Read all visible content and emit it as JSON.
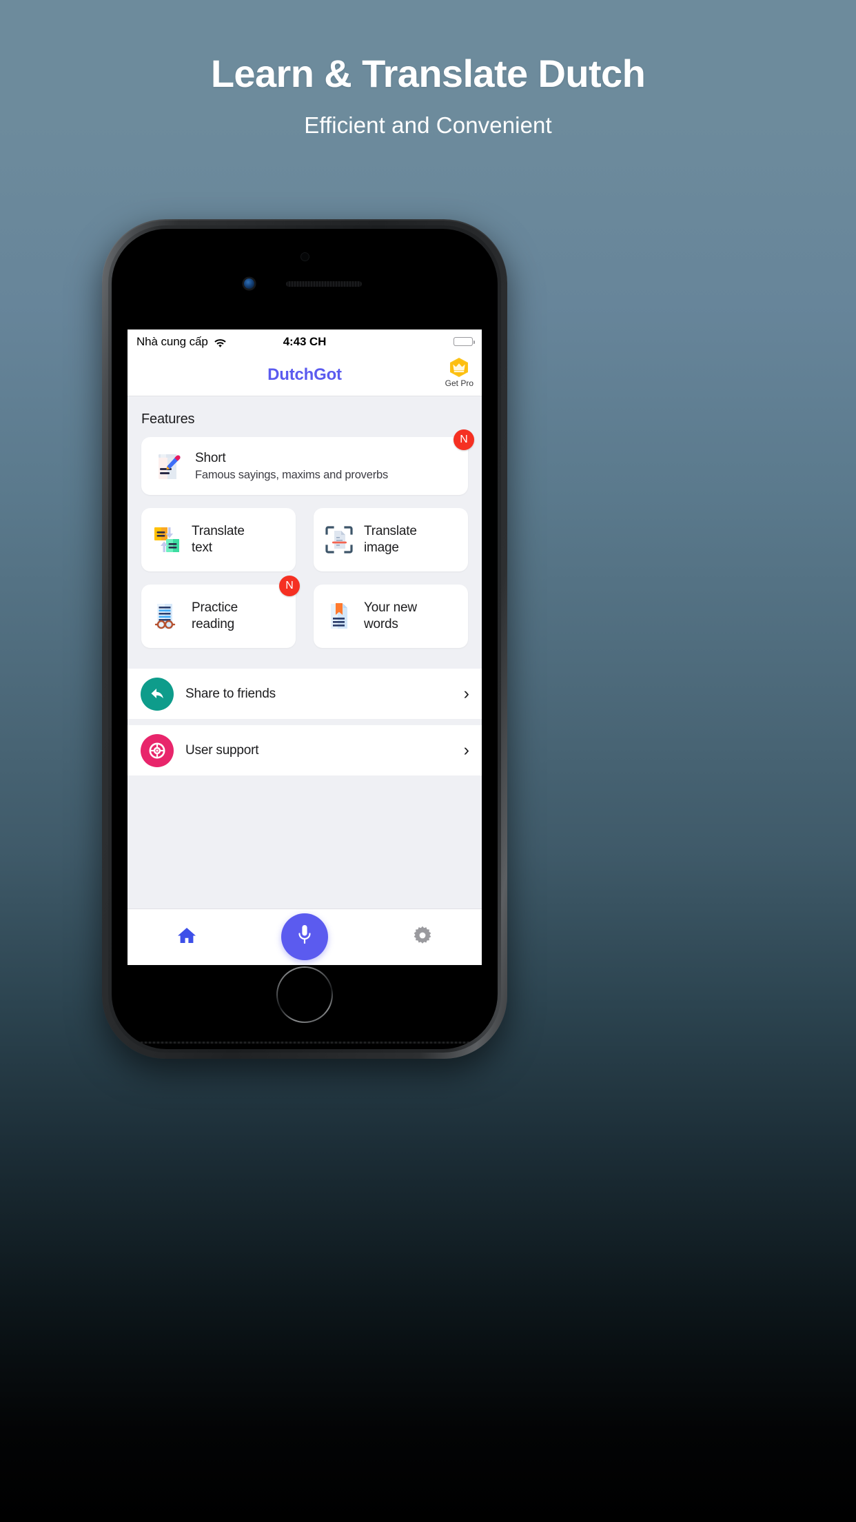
{
  "promo": {
    "title": "Learn & Translate Dutch",
    "subtitle": "Efficient and Convenient"
  },
  "colors": {
    "brand": "#5b5bef",
    "badge_red": "#f53022",
    "share_teal": "#0e9c8b",
    "support_pink": "#e8256b",
    "pro_gold": "#fcc419",
    "screen_bg": "#eff0f4"
  },
  "statusbar": {
    "carrier": "Nhà cung cấp",
    "wifi_icon": "wifi-icon",
    "time": "4:43 CH",
    "battery_icon": "battery-full-icon"
  },
  "navbar": {
    "app_title": "DutchGot",
    "get_pro": {
      "icon": "crown-hexagon-icon",
      "label": "Get Pro"
    }
  },
  "main": {
    "section_title": "Features",
    "featured_card": {
      "icon": "note-pencil-icon",
      "title": "Short",
      "subtitle": "Famous sayings, maxims and proverbs",
      "badge": "N"
    },
    "grid_cards": [
      {
        "icon": "translate-text-icon",
        "title": "Translate\ntext",
        "badge": ""
      },
      {
        "icon": "translate-image-icon",
        "title": "Translate\nimage",
        "badge": ""
      },
      {
        "icon": "reading-glasses-icon",
        "title": "Practice\nreading",
        "badge": "N"
      },
      {
        "icon": "bookmark-document-icon",
        "title": "Your new\nwords",
        "badge": ""
      }
    ],
    "rows": [
      {
        "icon": "share-arrow-icon",
        "label": "Share to friends",
        "chevron": "›"
      },
      {
        "icon": "lifebuoy-icon",
        "label": "User support",
        "chevron": "›"
      }
    ]
  },
  "tabbar": {
    "items": [
      {
        "icon": "home-icon",
        "label": ""
      },
      {
        "icon": "microphone-icon",
        "label": ""
      },
      {
        "icon": "gear-icon",
        "label": ""
      }
    ]
  }
}
